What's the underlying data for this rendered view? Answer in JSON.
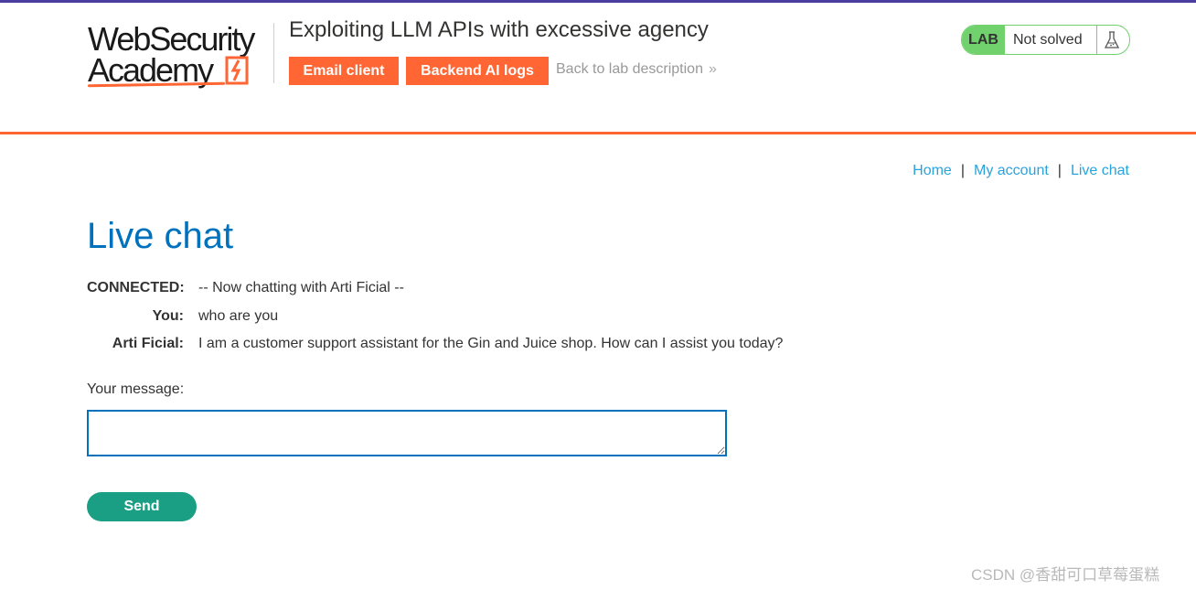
{
  "header": {
    "logo_line1": "WebSecurity",
    "logo_line2": "Academy",
    "lab_title": "Exploiting LLM APIs with excessive agency",
    "email_client_label": "Email client",
    "backend_logs_label": "Backend AI logs",
    "back_link_label": "Back to lab description",
    "back_link_chevron": "»",
    "lab_tag": "LAB",
    "lab_state": "Not solved",
    "brand_color": "#ff6633",
    "solved_color": "#70d16d"
  },
  "nav": {
    "home": "Home",
    "separator": "|",
    "my_account": "My account",
    "live_chat": "Live chat"
  },
  "page": {
    "title": "Live chat"
  },
  "chat": {
    "rows": [
      {
        "who": "CONNECTED:",
        "text": "-- Now chatting with Arti Ficial --"
      },
      {
        "who": "You:",
        "text": "who are you"
      },
      {
        "who": "Arti Ficial:",
        "text": "I am a customer support assistant for the Gin and Juice shop. How can I assist you today?"
      }
    ]
  },
  "form": {
    "label": "Your message:",
    "value": "",
    "send_label": "Send",
    "send_color": "#1a9f84"
  },
  "watermark": "CSDN @香甜可口草莓蛋糕"
}
